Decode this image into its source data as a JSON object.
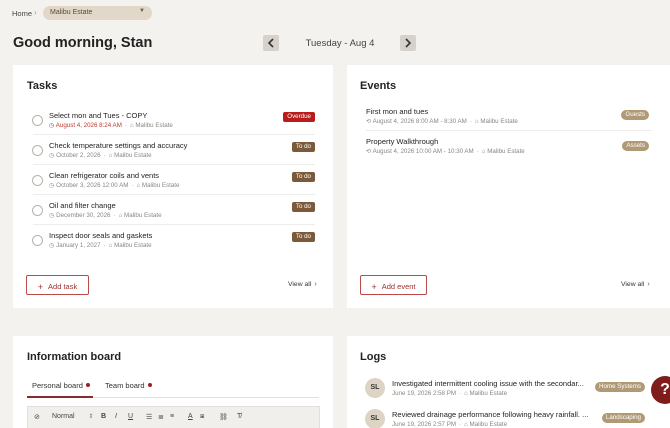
{
  "breadcrumb": {
    "home": "Home",
    "property": "Malibu Estate"
  },
  "header": {
    "greeting": "Good morning, Stan",
    "date": "Tuesday - Aug 4"
  },
  "tasks": {
    "title": "Tasks",
    "items": [
      {
        "title": "Select mon and Tues - COPY",
        "date": "August 4, 2026 8:24 AM",
        "property": "Malibu Estate",
        "status": "Overdue"
      },
      {
        "title": "Check temperature settings and accuracy",
        "date": "October 2, 2026",
        "property": "Malibu Estate",
        "status": "To do"
      },
      {
        "title": "Clean refrigerator coils and vents",
        "date": "October 3, 2026 12:00 AM",
        "property": "Malibu Estate",
        "status": "To do"
      },
      {
        "title": "Oil and filter change",
        "date": "December 30, 2026",
        "property": "Malibu Estate",
        "status": "To do"
      },
      {
        "title": "Inspect door seals and gaskets",
        "date": "January 1, 2027",
        "property": "Malibu Estate",
        "status": "To do"
      }
    ],
    "add_label": "Add task",
    "view_all": "View all"
  },
  "events": {
    "title": "Events",
    "items": [
      {
        "title": "First mon and tues",
        "time": "August 4, 2026 8:00 AM - 8:30 AM",
        "property": "Malibu Estate",
        "tag": "Guests"
      },
      {
        "title": "Property Walkthrough",
        "time": "August 4, 2026 10:00 AM - 10:30 AM",
        "property": "Malibu Estate",
        "tag": "Assets"
      }
    ],
    "add_label": "Add event",
    "view_all": "View all"
  },
  "info_board": {
    "title": "Information board",
    "tabs": [
      "Personal board",
      "Team board"
    ],
    "toolbar": {
      "style": "Normal",
      "bold": "B",
      "italic": "I",
      "underline": "U"
    }
  },
  "logs": {
    "title": "Logs",
    "items": [
      {
        "initials": "SL",
        "title": "Investigated intermittent cooling issue with the secondar...",
        "time": "June 19, 2026 2:58 PM",
        "property": "Malibu Estate",
        "tag": "Home Systems"
      },
      {
        "initials": "SL",
        "title": "Reviewed drainage performance following heavy rainfall. ...",
        "time": "June 19, 2026 2:57 PM",
        "property": "Malibu Estate",
        "tag": "Landscaping"
      }
    ]
  },
  "help": {
    "label": "?"
  },
  "colors": {
    "accent": "#8b2a2a",
    "overdue": "#b91c1c",
    "todo": "#7a5a3a",
    "tag": "#b09a76",
    "background": "#f4f2ee"
  }
}
